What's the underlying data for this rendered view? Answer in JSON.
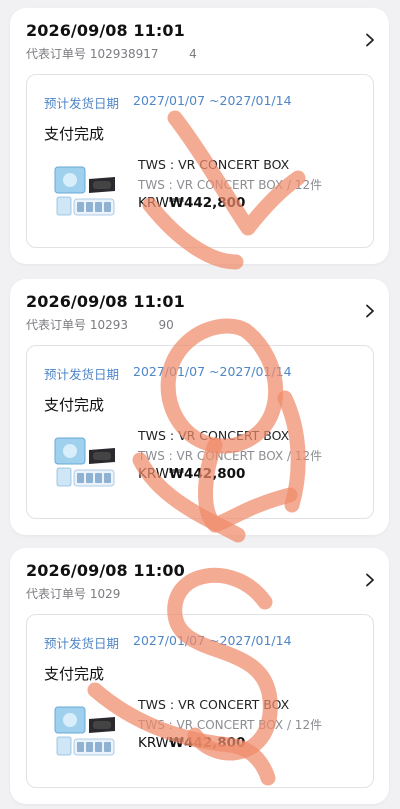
{
  "orders": [
    {
      "datetime": "2026/09/08 11:01",
      "order_no_label": "代表订单号",
      "order_no_visible": "102938917",
      "order_no_tail": "4",
      "ship_label": "预计发货日期",
      "ship_range": "2027/01/07 ~2027/01/14",
      "status": "支付完成",
      "product_name": "TWS : VR CONCERT BOX",
      "product_sub": "TWS : VR CONCERT BOX / 12件",
      "currency": "KRW",
      "price": "₩442,800"
    },
    {
      "datetime": "2026/09/08 11:01",
      "order_no_label": "代表订单号",
      "order_no_visible": "10293",
      "order_no_tail": "90",
      "ship_label": "预计发货日期",
      "ship_range": "2027/01/07 ~2027/01/14",
      "status": "支付完成",
      "product_name": "TWS : VR CONCERT BOX",
      "product_sub": "TWS : VR CONCERT BOX / 12件",
      "currency": "KRW",
      "price": "₩442,800"
    },
    {
      "datetime": "2026/09/08 11:00",
      "order_no_label": "代表订单号",
      "order_no_visible": "1029",
      "order_no_tail": "",
      "ship_label": "预计发货日期",
      "ship_range": "2027/01/07 ~2027/01/14",
      "status": "支付完成",
      "product_name": "TWS : VR CONCERT BOX",
      "product_sub": "TWS : VR CONCERT BOX / 12件",
      "currency": "KRW",
      "price": "₩442,800"
    }
  ],
  "icons": {
    "chevron": "chevron-right-icon",
    "product": "vr-concert-box-thumbnail"
  },
  "colors": {
    "accent_blue": "#4f86c6",
    "watermark": "#f08a6a",
    "page_bg": "#f1f1f3"
  }
}
